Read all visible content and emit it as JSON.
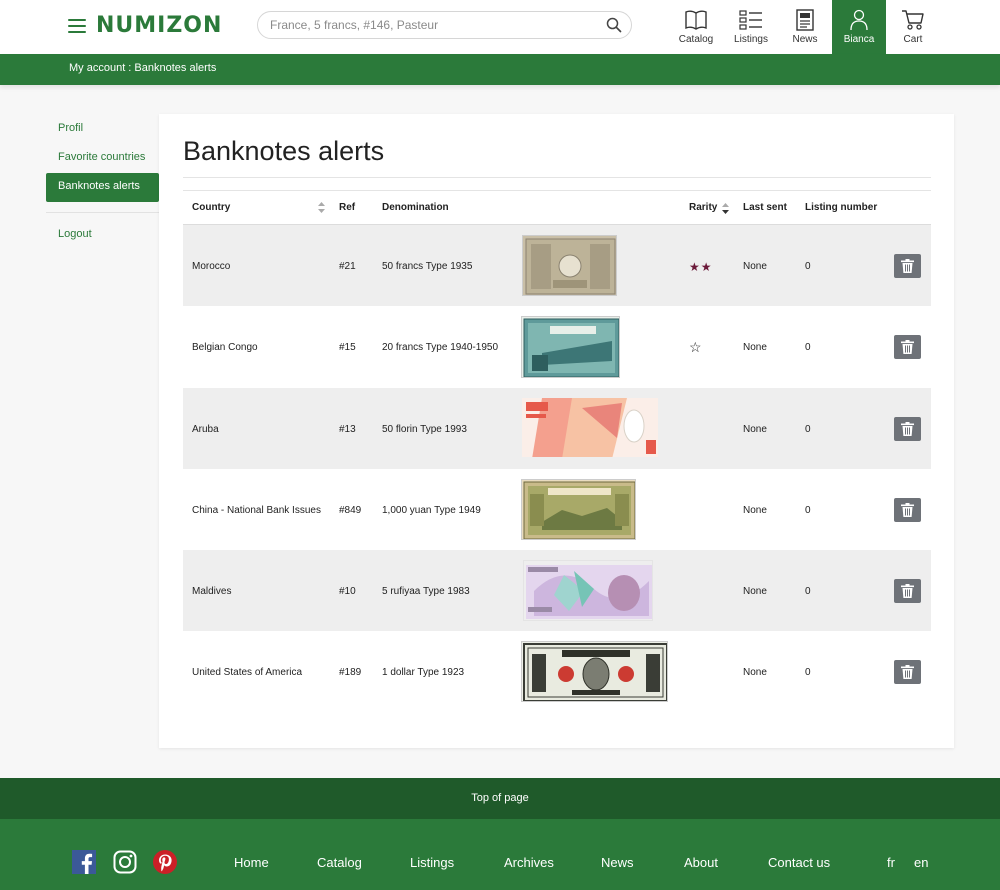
{
  "brand": {
    "logo_text": "NUMIZON",
    "accent": "#2b7a3a",
    "dark_accent": "#1f5a2a"
  },
  "search": {
    "placeholder": "France, 5 francs, #146, Pasteur",
    "value": ""
  },
  "nav": {
    "catalog": "Catalog",
    "listings": "Listings",
    "news": "News",
    "account": "Bianca",
    "cart": "Cart"
  },
  "breadcrumb": "My account : Banknotes alerts",
  "sidebar": {
    "items": [
      {
        "label": "Profil"
      },
      {
        "label": "Favorite countries"
      },
      {
        "label": "Banknotes alerts",
        "active": true
      }
    ],
    "logout": "Logout"
  },
  "page_title": "Banknotes alerts",
  "table": {
    "headers": {
      "country": "Country",
      "ref": "Ref",
      "denomination": "Denomination",
      "rarity": "Rarity",
      "last_sent": "Last sent",
      "listing_number": "Listing number"
    },
    "rows": [
      {
        "country": "Morocco",
        "ref": "#21",
        "denomination": "50 francs Type 1935",
        "rarity": "filled-2-stars",
        "last_sent": "None",
        "listing_number": "0"
      },
      {
        "country": "Belgian Congo",
        "ref": "#15",
        "denomination": "20 francs Type 1940-1950",
        "rarity": "empty-1-star",
        "last_sent": "None",
        "listing_number": "0"
      },
      {
        "country": "Aruba",
        "ref": "#13",
        "denomination": "50 florin Type 1993",
        "rarity": "",
        "last_sent": "None",
        "listing_number": "0"
      },
      {
        "country": "China - National Bank Issues",
        "ref": "#849",
        "denomination": "1,000 yuan Type 1949",
        "rarity": "",
        "last_sent": "None",
        "listing_number": "0"
      },
      {
        "country": "Maldives",
        "ref": "#10",
        "denomination": "5 rufiyaa Type 1983",
        "rarity": "",
        "last_sent": "None",
        "listing_number": "0"
      },
      {
        "country": "United States of America",
        "ref": "#189",
        "denomination": "1 dollar Type 1923",
        "rarity": "",
        "last_sent": "None",
        "listing_number": "0"
      }
    ]
  },
  "rarity_marks": {
    "filled": "★★",
    "empty": "☆"
  },
  "footer": {
    "top_of_page": "Top of page",
    "links": [
      "Home",
      "Catalog",
      "Listings",
      "Archives",
      "News",
      "About",
      "Contact us"
    ],
    "languages": [
      "fr",
      "en"
    ]
  }
}
